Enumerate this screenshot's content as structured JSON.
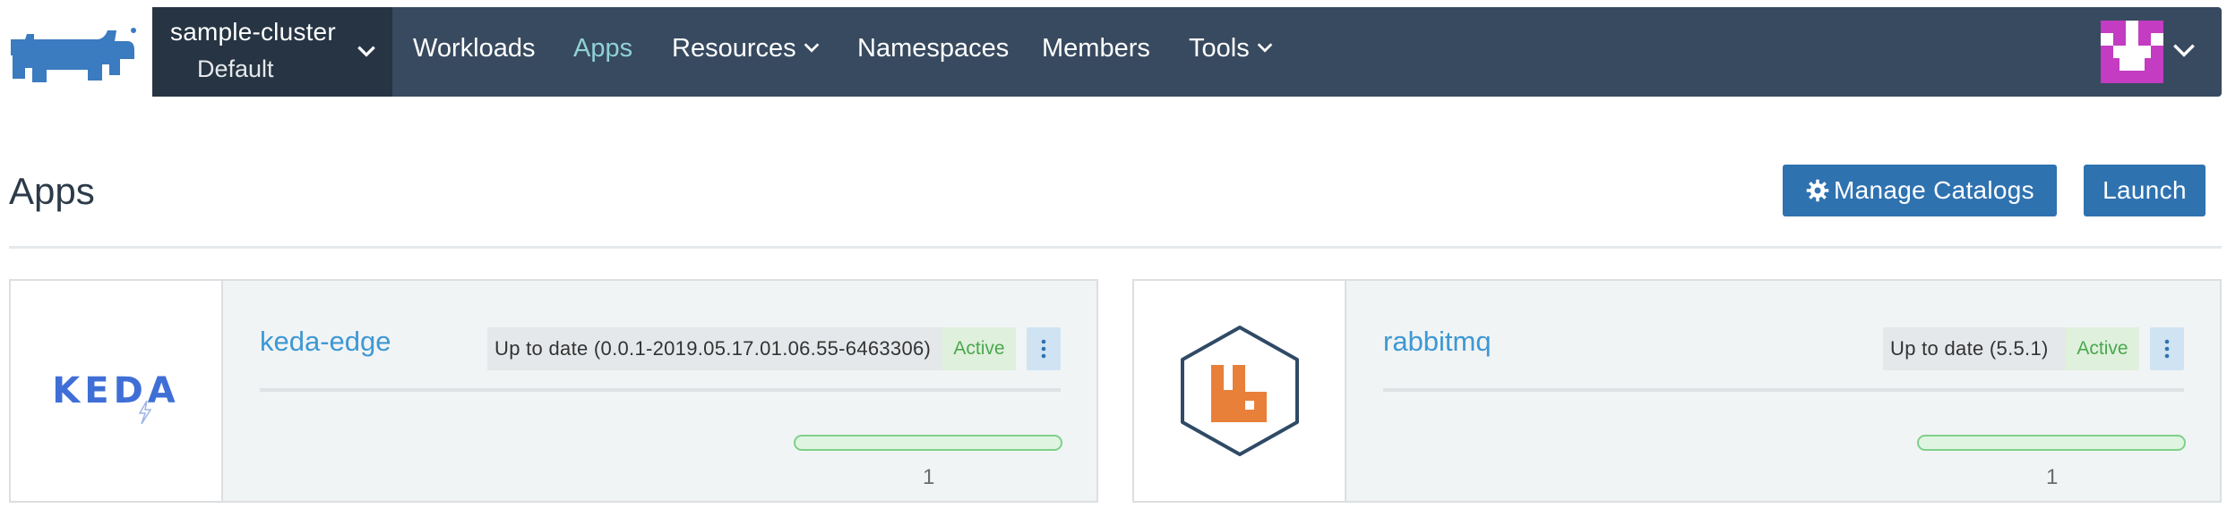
{
  "header": {
    "cluster_name": "sample-cluster",
    "project_name": "Default",
    "nav": [
      {
        "label": "Workloads"
      },
      {
        "label": "Apps",
        "active": true
      },
      {
        "label": "Resources",
        "has_dropdown": true
      },
      {
        "label": "Namespaces"
      },
      {
        "label": "Members"
      },
      {
        "label": "Tools",
        "has_dropdown": true
      }
    ],
    "colors": {
      "navbar": "#384a5f",
      "cluster": "#263443",
      "active": "#8fd2d6",
      "avatar": "#c33cc1"
    }
  },
  "page": {
    "title": "Apps",
    "manage_catalogs_label": "Manage Catalogs",
    "launch_label": "Launch"
  },
  "apps": [
    {
      "name": "keda-edge",
      "logo_text": "KEDA",
      "version_status": "Up to date (0.0.1-2019.05.17.01.06.55-6463306)",
      "state": "Active",
      "progress": 1.0,
      "count": "1"
    },
    {
      "name": "rabbitmq",
      "logo": "rabbitmq-icon",
      "version_status": "Up to date (5.5.1)",
      "state": "Active",
      "progress": 1.0,
      "count": "1"
    }
  ]
}
